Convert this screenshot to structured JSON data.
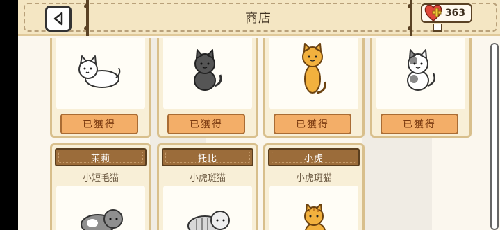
{
  "header": {
    "title": "商店",
    "currency_value": "363",
    "currency_icon": "heart-plus-icon",
    "back_icon": "back-triangle-icon"
  },
  "owned_cards": [
    {
      "cat_icon": "white-cat-lying-icon",
      "button_label": "已獲得"
    },
    {
      "cat_icon": "black-cat-sitting-icon",
      "button_label": "已獲得"
    },
    {
      "cat_icon": "orange-cat-standing-icon",
      "button_label": "已獲得"
    },
    {
      "cat_icon": "calico-cat-sitting-icon",
      "button_label": "已獲得"
    }
  ],
  "cat_cards": [
    {
      "name": "茉莉",
      "breed": "小短毛猫",
      "cat_icon": "gray-tabby-cat-icon"
    },
    {
      "name": "托比",
      "breed": "小虎斑猫",
      "cat_icon": "silver-tabby-cat-icon"
    },
    {
      "name": "小虎",
      "breed": "小虎斑猫",
      "cat_icon": "orange-tabby-cat-icon"
    }
  ],
  "colors": {
    "button": "#f3ae68",
    "name_plate": "#9b6c3a",
    "card_border": "#d8bf8c",
    "header": "#f4e6c3"
  }
}
